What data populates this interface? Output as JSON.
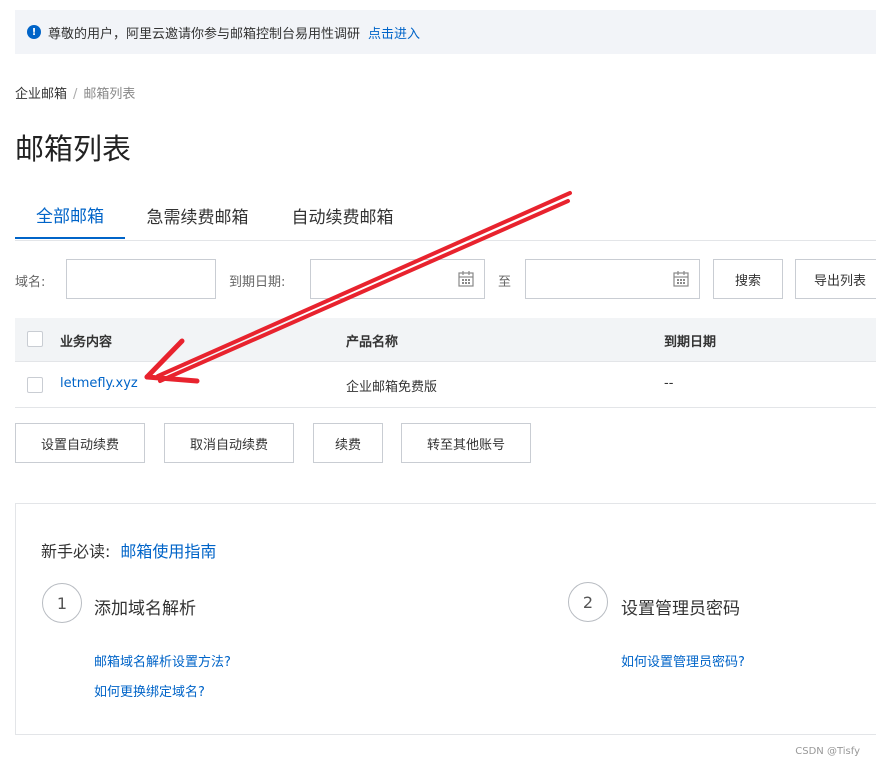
{
  "notice": {
    "icon": "info-icon",
    "text": "尊敬的用户，阿里云邀请你参与邮箱控制台易用性调研",
    "link": "点击进入"
  },
  "breadcrumb": {
    "root": "企业邮箱",
    "separator": "/",
    "current": "邮箱列表"
  },
  "page_title": "邮箱列表",
  "tabs": [
    {
      "label": "全部邮箱",
      "active": true
    },
    {
      "label": "急需续费邮箱",
      "active": false
    },
    {
      "label": "自动续费邮箱",
      "active": false
    }
  ],
  "filters": {
    "domain_label": "域名:",
    "domain_value": "",
    "expire_label": "到期日期:",
    "to_label": "至",
    "start_value": "",
    "end_value": "",
    "search_button": "搜索",
    "export_button": "导出列表"
  },
  "table": {
    "columns": [
      "业务内容",
      "产品名称",
      "到期日期"
    ],
    "rows": [
      {
        "business": "letmefly.xyz",
        "product": "企业邮箱免费版",
        "expire": "--"
      }
    ]
  },
  "actions": {
    "set_auto_renew": "设置自动续费",
    "cancel_auto_renew": "取消自动续费",
    "renew": "续费",
    "transfer": "转至其他账号"
  },
  "guide": {
    "prefix": "新手必读:",
    "title_link": "邮箱使用指南",
    "steps": [
      {
        "number": "1",
        "title": "添加域名解析",
        "links": [
          "邮箱域名解析设置方法?",
          "如何更换绑定域名?"
        ]
      },
      {
        "number": "2",
        "title": "设置管理员密码",
        "links": [
          "如何设置管理员密码?"
        ]
      }
    ]
  },
  "watermark": "CSDN @Tisfy",
  "colors": {
    "accent": "#0064c8",
    "annotation_arrow": "#e8232e",
    "header_bg": "#f2f4f6"
  }
}
